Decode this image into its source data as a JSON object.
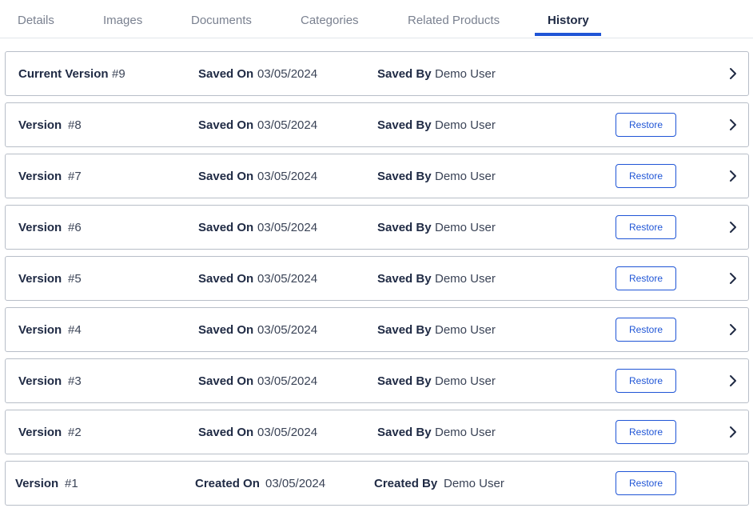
{
  "tabs": [
    {
      "label": "Details"
    },
    {
      "label": "Images"
    },
    {
      "label": "Documents"
    },
    {
      "label": "Categories"
    },
    {
      "label": "Related Products"
    },
    {
      "label": "History",
      "active": true
    }
  ],
  "colors": {
    "accent": "#1f55d6",
    "border": "#b8bec8",
    "text": "#1f2a44",
    "muted": "#7a8190"
  },
  "versions": [
    {
      "version_label": "Current Version",
      "number": "#9",
      "date_label": "Saved On",
      "date": "03/05/2024",
      "user_label": "Saved By",
      "user": "Demo User",
      "restore": null,
      "chevron": "chevron-right-icon"
    },
    {
      "version_label": "Version",
      "number": "#8",
      "date_label": "Saved On",
      "date": "03/05/2024",
      "user_label": "Saved By",
      "user": "Demo User",
      "restore": "Restore",
      "chevron": "chevron-right-icon"
    },
    {
      "version_label": "Version",
      "number": "#7",
      "date_label": "Saved On",
      "date": "03/05/2024",
      "user_label": "Saved By",
      "user": "Demo User",
      "restore": "Restore",
      "chevron": "chevron-right-icon"
    },
    {
      "version_label": "Version",
      "number": "#6",
      "date_label": "Saved On",
      "date": "03/05/2024",
      "user_label": "Saved By",
      "user": "Demo User",
      "restore": "Restore",
      "chevron": "chevron-right-icon"
    },
    {
      "version_label": "Version",
      "number": "#5",
      "date_label": "Saved On",
      "date": "03/05/2024",
      "user_label": "Saved By",
      "user": "Demo User",
      "restore": "Restore",
      "chevron": "chevron-right-icon"
    },
    {
      "version_label": "Version",
      "number": "#4",
      "date_label": "Saved On",
      "date": "03/05/2024",
      "user_label": "Saved By",
      "user": "Demo User",
      "restore": "Restore",
      "chevron": "chevron-right-icon"
    },
    {
      "version_label": "Version",
      "number": "#3",
      "date_label": "Saved On",
      "date": "03/05/2024",
      "user_label": "Saved By",
      "user": "Demo User",
      "restore": "Restore",
      "chevron": "chevron-right-icon"
    },
    {
      "version_label": "Version",
      "number": "#2",
      "date_label": "Saved On",
      "date": "03/05/2024",
      "user_label": "Saved By",
      "user": "Demo User",
      "restore": "Restore",
      "chevron": "chevron-right-icon"
    },
    {
      "version_label": "Version",
      "number": "#1",
      "date_label": "Created On",
      "date": "03/05/2024",
      "user_label": "Created By",
      "user": "Demo User",
      "restore": "Restore",
      "chevron": null
    }
  ]
}
